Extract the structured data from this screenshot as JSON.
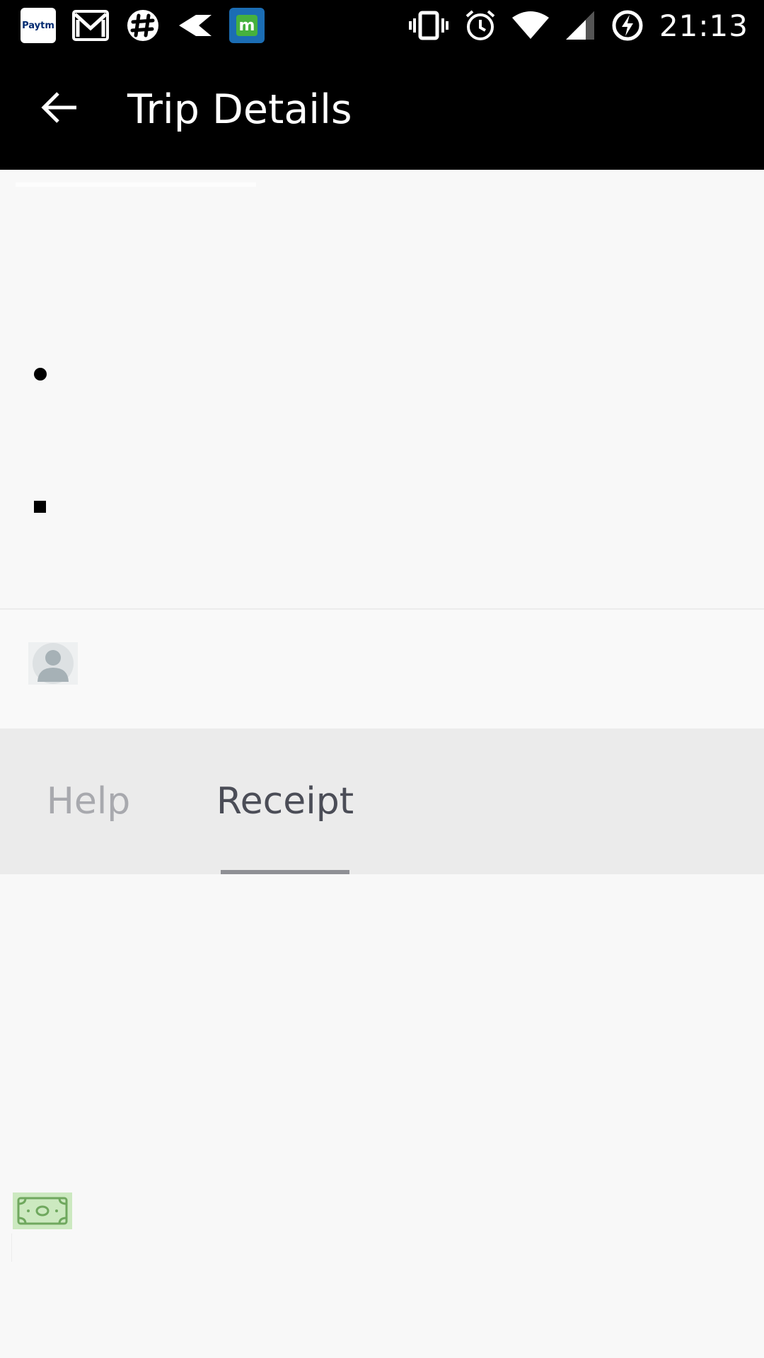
{
  "status_bar": {
    "time": "21:13",
    "notification_icons": [
      "paytm-icon",
      "gmail-icon",
      "slack-icon",
      "kite-icon",
      "magicpin-icon"
    ],
    "paytm_label": "Paytm",
    "magicpin_label": "m",
    "system_icons": [
      "vibrate-icon",
      "alarm-icon",
      "wifi-icon",
      "cell-signal-icon",
      "battery-charging-icon"
    ]
  },
  "toolbar": {
    "title": "Trip Details",
    "back_icon": "arrow-back-icon"
  },
  "route": {
    "pickup_marker": "circle",
    "dropoff_marker": "square"
  },
  "tabs": [
    {
      "label": "Help",
      "selected": false
    },
    {
      "label": "Receipt",
      "selected": true
    }
  ],
  "colors": {
    "toolbar_bg": "#000000",
    "page_bg": "#f8f8f8",
    "tab_bar_bg": "#ebebeb",
    "tab_selected_text": "#4b4d57",
    "tab_unselected_text": "#a8a9ae",
    "cash_icon_bg": "#cce9c0"
  }
}
